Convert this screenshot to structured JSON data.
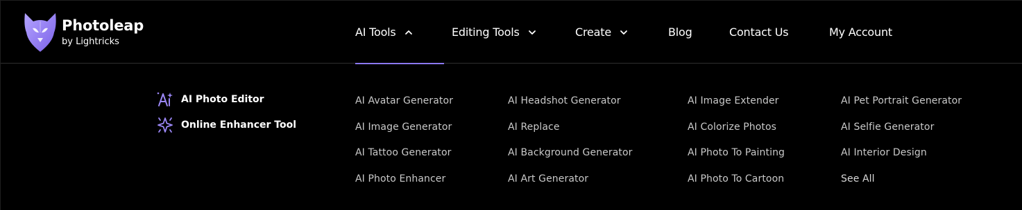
{
  "brand": {
    "name": "Photoleap",
    "tagline": "by Lightricks"
  },
  "nav": {
    "items": [
      {
        "label": "AI Tools",
        "state": "expanded"
      },
      {
        "label": "Editing Tools",
        "state": "collapsed"
      },
      {
        "label": "Create",
        "state": "collapsed"
      },
      {
        "label": "Blog"
      },
      {
        "label": "Contact Us"
      },
      {
        "label": "My Account"
      }
    ]
  },
  "dropdown": {
    "featured": [
      {
        "label": "AI Photo Editor",
        "icon": "ai-sparkle-icon"
      },
      {
        "label": "Online Enhancer Tool",
        "icon": "enhancer-sparkle-icon"
      }
    ],
    "columns": [
      [
        "AI Avatar Generator",
        "AI Image Generator",
        "AI Tattoo Generator",
        "AI Photo Enhancer"
      ],
      [
        "AI Headshot Generator",
        "AI Replace",
        "AI Background Generator",
        "AI Art Generator"
      ],
      [
        "AI Image Extender",
        "AI Colorize Photos",
        "AI Photo To Painting",
        "AI Photo To Cartoon"
      ],
      [
        "AI Pet Portrait Generator",
        "AI Selfie Generator",
        "AI Interior Design",
        "See All"
      ]
    ]
  },
  "colors": {
    "background": "#000000",
    "accent": "#8b78f0",
    "logo_purple": "#9b87f5",
    "link_text": "#c9c9c9",
    "nav_text": "#ffffff"
  }
}
